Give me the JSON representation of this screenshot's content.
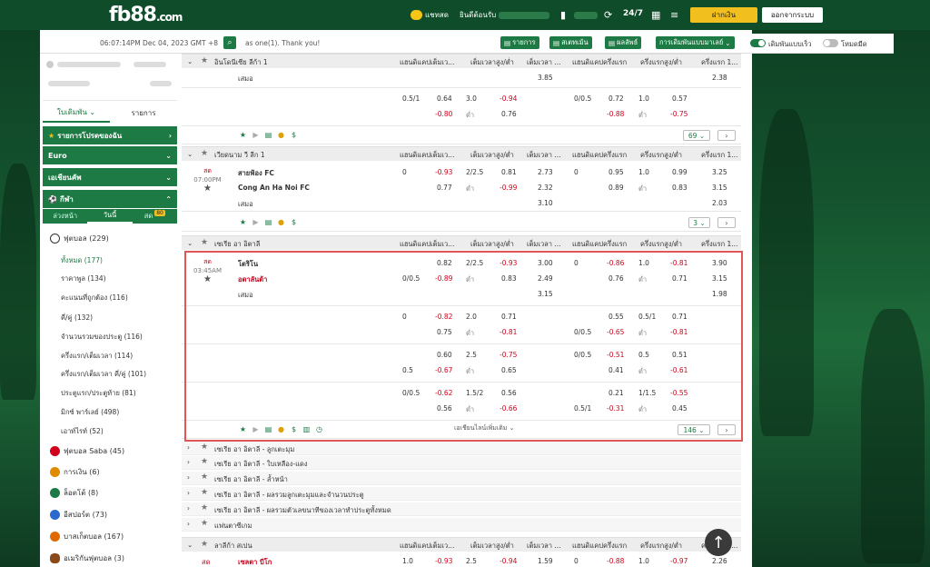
{
  "brand": {
    "logo": "fb88",
    "logo_suffix": ".com"
  },
  "topbar": {
    "chat": "แชทสด",
    "welcome": "ยินดีต้อนรับ",
    "deposit": "ฝากเงิน",
    "logout": "ออกจากระบบ"
  },
  "toolbar": {
    "datetime": "06:07:14PM Dec 04, 2023 GMT +8",
    "marquee": "as one(1). Thank you!",
    "items_btn": "รายการ",
    "statement_btn": "สเตทเม้น",
    "results_btn": "ผลลัพธ์",
    "bet_type_btn": "การเดิมพันแบบมาเลย์",
    "quick_bet_label": "เดิมพันแบบเร็ว",
    "dark_mode_label": "โหมดมืด"
  },
  "sidebar": {
    "tab_bets": "ใบเดิมพัน",
    "tab_list": "รายการ",
    "my_items": "รายการโปรดของฉัน",
    "euro": "Euro",
    "asian": "เอเชียนคัพ",
    "sports": "กีฬา",
    "sub_tabs": [
      "ล่วงหน้า",
      "วันนี้",
      "สด"
    ],
    "live_count": "80",
    "football": "ฟุตบอล (229)",
    "football_items": [
      {
        "label": "ทั้งหมด (177)"
      },
      {
        "label": "ราคาพูล (134)"
      },
      {
        "label": "คะแนนที่ถูกต้อง (116)"
      },
      {
        "label": "คี่/คู่ (132)"
      },
      {
        "label": "จำนวนรวมของประตู (116)"
      },
      {
        "label": "ครึ่งแรก/เต็มเวลา (114)"
      },
      {
        "label": "ครึ่งแรก/เต็มเวลา คี่/คู่ (101)"
      },
      {
        "label": "ประตูแรก/ประตูท้าย (81)"
      },
      {
        "label": "มิกซ์ พาร์เลย์ (498)"
      },
      {
        "label": "เอาท์ไรท์ (52)"
      }
    ],
    "other_sports": [
      {
        "label": "ฟุตบอล Saba (45)",
        "color": "#d0021b"
      },
      {
        "label": "การเงิน (6)",
        "color": "#e08a00"
      },
      {
        "label": "ล็อตโต้ (8)",
        "color": "#1e7a44"
      },
      {
        "label": "อีสปอร์ต (73)",
        "color": "#2a6acf"
      },
      {
        "label": "บาสเก็ตบอล (167)",
        "color": "#e06a00"
      },
      {
        "label": "อเมริกันฟุตบอล (3)",
        "color": "#8a4a1a"
      }
    ]
  },
  "columns": [
    "แฮนดิแคปเต็มเว...",
    "เต็มเวลาสูง/ต่ำ",
    "เต็มเวลา ...",
    "แฮนดิแคปครึ่งแรก",
    "ครึ่งแรกสูง/ต่ำ",
    "ครึ่งแรก 1..."
  ],
  "leagues": {
    "l1": "อินโดนีเซีย ลีก้า 1",
    "l2": "เวียดนาม วี ลีก 1",
    "l3": "เซเรีย อา อิตาลี",
    "l5": "ลาลีก้า สเปน"
  },
  "league1": {
    "draw": "เสมอ",
    "draw_odds": "3.85",
    "draw_ht": "2.38",
    "r1": [
      "0.5/1",
      "0.64",
      "3.0",
      "-0.94",
      "0/0.5",
      "0.72",
      "1.0",
      "0.57"
    ],
    "r2": [
      "-0.80",
      "ต่ำ",
      "0.76",
      "-0.88",
      "ต่ำ",
      "-0.75"
    ],
    "more": "69"
  },
  "league2": {
    "live": "สด",
    "time": "07:00PM",
    "home": "สายฟ้อง FC",
    "away": "Cong An Ha Noi FC",
    "draw": "เสมอ",
    "home_odds": [
      "0",
      "-0.93",
      "2/2.5",
      "0.81",
      "2.73",
      "0",
      "0.95",
      "1.0",
      "0.99",
      "3.25"
    ],
    "away_odds": [
      "0.77",
      "ต่ำ",
      "-0.99",
      "2.32",
      "0.89",
      "ต่ำ",
      "0.83",
      "3.15"
    ],
    "draw_odds": [
      "3.10",
      "2.03"
    ],
    "more": "3"
  },
  "league3": {
    "live": "สด",
    "time": "03:45AM",
    "home": "โตริโน",
    "away": "อตาลันต้า",
    "draw": "เสมอ",
    "main": [
      [
        "",
        "0.82",
        "2/2.5",
        "-0.93",
        "3.00",
        "0",
        "-0.86",
        "1.0",
        "-0.81",
        "3.90"
      ],
      [
        "0/0.5",
        "-0.89",
        "ต่ำ",
        "0.83",
        "2.49",
        "",
        "0.76",
        "ต่ำ",
        "0.71",
        "3.15"
      ],
      [
        "",
        "",
        "",
        "",
        "3.15",
        "",
        "",
        "",
        "",
        "1.98"
      ]
    ],
    "alt": [
      [
        "0",
        "-0.82",
        "2.0",
        "0.71",
        "",
        "0.55",
        "0.5/1",
        "0.71"
      ],
      [
        "",
        "0.75",
        "ต่ำ",
        "-0.81",
        "0/0.5",
        "-0.65",
        "ต่ำ",
        "-0.81"
      ],
      [
        "",
        "0.60",
        "2.5",
        "-0.75",
        "0/0.5",
        "-0.51",
        "0.5",
        "0.51"
      ],
      [
        "0.5",
        "-0.67",
        "ต่ำ",
        "0.65",
        "",
        "0.41",
        "ต่ำ",
        "-0.61"
      ],
      [
        "0/0.5",
        "-0.62",
        "1.5/2",
        "0.56",
        "",
        "0.21",
        "1/1.5",
        "-0.55"
      ],
      [
        "",
        "0.56",
        "ต่ำ",
        "-0.66",
        "0.5/1",
        "-0.31",
        "ต่ำ",
        "0.45"
      ]
    ],
    "more_bets": "เอเชียนไลน์เพิ่มเติม",
    "more": "146"
  },
  "collapsed": [
    "เซเรีย อา อิตาลี - ลูกเตะมุม",
    "เซเรีย อา อิตาลี - ใบเหลือง-แดง",
    "เซเรีย อา อิตาลี - ล้ำหน้า",
    "เซเรีย อา อิตาลี - ผลรวมลูกเตะมุมและจำนวนประตู",
    "เซเรีย อา อิตาลี - ผลรวมตัวเลขนาทีของเวลาทำประตูทั้งหมด",
    "แฟนตาซีเกม"
  ],
  "league5": {
    "live": "สด",
    "home": "เซลตา บีโก",
    "odds": [
      "1.0",
      "-0.93",
      "2.5",
      "-0.94",
      "1.59",
      "0",
      "-0.88",
      "1.0",
      "-0.97",
      "2.26"
    ]
  }
}
